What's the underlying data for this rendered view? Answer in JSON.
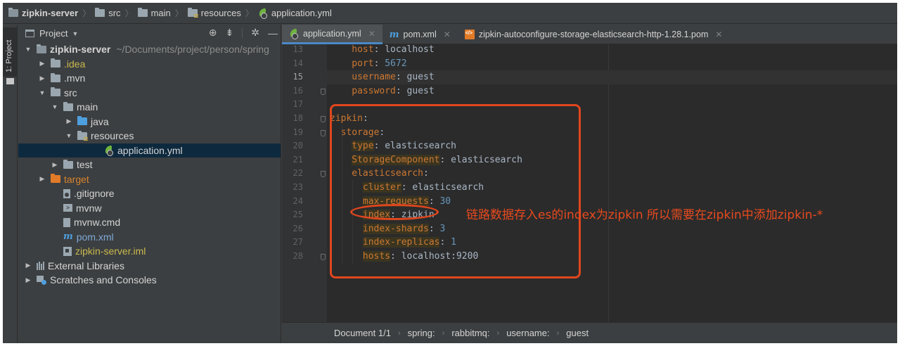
{
  "navbar": {
    "crumbs": [
      "zipkin-server",
      "src",
      "main",
      "resources",
      "application.yml"
    ]
  },
  "toolstrip": {
    "project_tab": "1: Project"
  },
  "project_panel": {
    "title": "Project",
    "tree": [
      {
        "label": "zipkin-server",
        "hint": "~/Documents/project/person/spring",
        "arrow": "▼",
        "indent": 0,
        "icon": "module-folder-icon",
        "color": "bold"
      },
      {
        "label": ".idea",
        "arrow": "▶",
        "indent": 1,
        "icon": "folder-icon",
        "color": "yellow"
      },
      {
        "label": ".mvn",
        "arrow": "▶",
        "indent": 1,
        "icon": "folder-icon",
        "color": ""
      },
      {
        "label": "src",
        "arrow": "▼",
        "indent": 1,
        "icon": "folder-icon",
        "color": ""
      },
      {
        "label": "main",
        "arrow": "▼",
        "indent": 2,
        "icon": "folder-icon",
        "color": ""
      },
      {
        "label": "java",
        "arrow": "▶",
        "indent": 3,
        "icon": "source-folder-icon",
        "color": ""
      },
      {
        "label": "resources",
        "arrow": "▼",
        "indent": 3,
        "icon": "resources-folder-icon",
        "color": ""
      },
      {
        "label": "application.yml",
        "arrow": "",
        "indent": 5,
        "icon": "spring-yml-icon",
        "color": "",
        "selected": true
      },
      {
        "label": "test",
        "arrow": "▶",
        "indent": 2,
        "icon": "folder-icon",
        "color": ""
      },
      {
        "label": "target",
        "arrow": "▶",
        "indent": 1,
        "icon": "excluded-folder-icon",
        "color": "orange"
      },
      {
        "label": ".gitignore",
        "arrow": "",
        "indent": 2,
        "icon": "gitignore-icon",
        "color": ""
      },
      {
        "label": "mvnw",
        "arrow": "",
        "indent": 2,
        "icon": "terminal-file-icon",
        "color": ""
      },
      {
        "label": "mvnw.cmd",
        "arrow": "",
        "indent": 2,
        "icon": "file-icon",
        "color": ""
      },
      {
        "label": "pom.xml",
        "arrow": "",
        "indent": 2,
        "icon": "maven-icon",
        "color": "lblue"
      },
      {
        "label": "zipkin-server.iml",
        "arrow": "",
        "indent": 2,
        "icon": "iml-file-icon",
        "color": "yellow"
      },
      {
        "label": "External Libraries",
        "arrow": "▶",
        "indent": 0,
        "icon": "libraries-icon",
        "color": ""
      },
      {
        "label": "Scratches and Consoles",
        "arrow": "▶",
        "indent": 0,
        "icon": "scratches-icon",
        "color": ""
      }
    ]
  },
  "tabs": [
    {
      "label": "application.yml",
      "icon": "spring-yml-icon",
      "active": true
    },
    {
      "label": "pom.xml",
      "icon": "maven-icon",
      "active": false
    },
    {
      "label": "zipkin-autoconfigure-storage-elasticsearch-http-1.28.1.pom",
      "icon": "pom-file-icon",
      "active": false
    }
  ],
  "editor": {
    "current_line": 15,
    "lines": [
      {
        "num": 13,
        "indent": 4,
        "key": "host",
        "value": "localhost",
        "value_type": "str"
      },
      {
        "num": 14,
        "indent": 4,
        "key": "port",
        "value": "5672",
        "value_type": "num"
      },
      {
        "num": 15,
        "indent": 4,
        "key": "username",
        "value": "guest",
        "value_type": "str"
      },
      {
        "num": 16,
        "indent": 4,
        "key": "password",
        "value": "guest",
        "value_type": "str"
      },
      {
        "num": 17,
        "indent": 0,
        "key": "",
        "value": "",
        "value_type": "str"
      },
      {
        "num": 18,
        "indent": 0,
        "key": "zipkin",
        "value": "",
        "value_type": "str"
      },
      {
        "num": 19,
        "indent": 2,
        "key": "storage",
        "value": "",
        "value_type": "str"
      },
      {
        "num": 20,
        "indent": 4,
        "key": "type",
        "value": "elasticsearch",
        "value_type": "str",
        "hl": true
      },
      {
        "num": 21,
        "indent": 4,
        "key": "StorageComponent",
        "value": "elasticsearch",
        "value_type": "str",
        "hl": true
      },
      {
        "num": 22,
        "indent": 4,
        "key": "elasticsearch",
        "value": "",
        "value_type": "str"
      },
      {
        "num": 23,
        "indent": 6,
        "key": "cluster",
        "value": "elasticsearch",
        "value_type": "str",
        "hl": true
      },
      {
        "num": 24,
        "indent": 6,
        "key": "max-requests",
        "value": "30",
        "value_type": "num",
        "hl": true
      },
      {
        "num": 25,
        "indent": 6,
        "key": "index",
        "value": "zipkin",
        "value_type": "str",
        "hl": true
      },
      {
        "num": 26,
        "indent": 6,
        "key": "index-shards",
        "value": "3",
        "value_type": "num",
        "hl": true
      },
      {
        "num": 27,
        "indent": 6,
        "key": "index-replicas",
        "value": "1",
        "value_type": "num",
        "hl": true
      },
      {
        "num": 28,
        "indent": 6,
        "key": "hosts",
        "value": "localhost:9200",
        "value_type": "str",
        "hl": true
      }
    ]
  },
  "annotation": {
    "text": "链路数据存入es的index为zipkin 所以需要在zipkin中添加zipkin-*",
    "color": "#e0461e"
  },
  "breadcrumbs": [
    "Document 1/1",
    "spring:",
    "rabbitmq:",
    "username:",
    "guest"
  ],
  "colors": {
    "key": "#cc7832",
    "string": "#a9b7c6",
    "number": "#6897bb",
    "selection": "#0d293e",
    "tab_accent": "#4a88c7"
  }
}
